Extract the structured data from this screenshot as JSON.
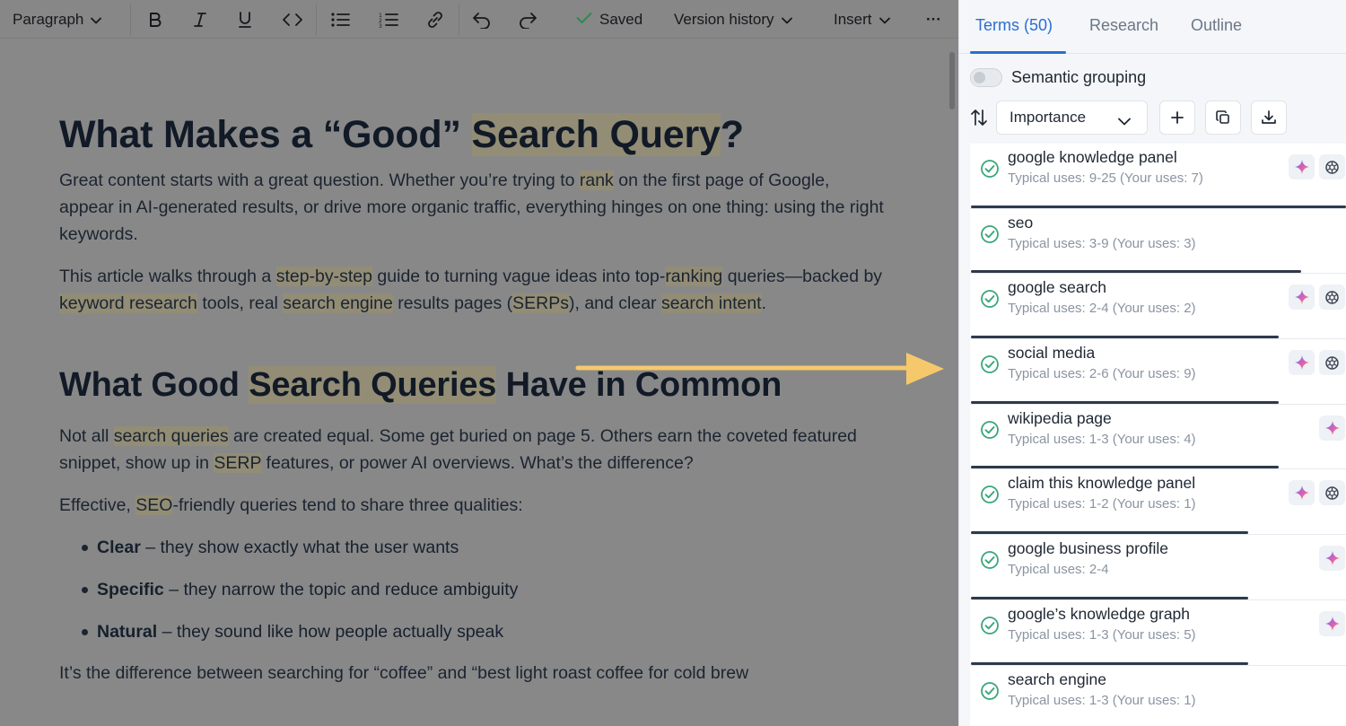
{
  "toolbar": {
    "paragraph_label": "Paragraph",
    "saved_label": "Saved",
    "version_history_label": "Version history",
    "insert_label": "Insert",
    "more_label": "···"
  },
  "document": {
    "h1_a": "What Makes a “Good” ",
    "h1_b": "Search Query",
    "h1_c": "?",
    "p1": [
      "Great content starts with a great question. Whether you’re trying to ",
      "rank",
      " on the first page of Google, appear in AI-generated results, or drive more organic traffic, everything hinges on one thing: using the right keywords."
    ],
    "p2": [
      "This article walks through a ",
      "step-by-step",
      " guide to turning vague ideas into top-",
      "ranking",
      " queries—backed by ",
      "keyword research",
      " tools, real ",
      "search engine",
      " results pages (",
      "SERPs",
      "), and clear ",
      "search intent",
      "."
    ],
    "h2_a": "What Good ",
    "h2_b": "Search Queries",
    "h2_c": " Have in Common",
    "p3": [
      "Not all ",
      "search queries",
      " are created equal. Some get buried on page 5. Others earn the coveted featured snippet, show up in ",
      "SERP",
      " features, or power AI overviews. What’s the difference?"
    ],
    "p4": [
      "Effective, ",
      "SEO",
      "-friendly queries tend to share three qualities:"
    ],
    "bullets": [
      {
        "term": "Clear",
        "rest": " – they show exactly what the user wants"
      },
      {
        "term": "Specific",
        "rest": " – they narrow the topic and reduce ambiguity"
      },
      {
        "term": "Natural",
        "rest": " – they sound like how people actually speak"
      }
    ],
    "p5": "It’s the difference between searching for “coffee” and “best light roast coffee for cold brew"
  },
  "panel": {
    "tabs": [
      "Terms (50)",
      "Research",
      "Outline"
    ],
    "active_tab": "Terms (50)",
    "semantic_grouping_label": "Semantic grouping",
    "sort_select_value": "Importance",
    "terms": [
      {
        "name": "google knowledge panel",
        "uses": "Typical uses: 9-25 (Your uses: 7)",
        "progress": 1.0,
        "actions": [
          "gemini-icon",
          "openai-icon"
        ]
      },
      {
        "name": "seo",
        "uses": "Typical uses: 3-9 (Your uses: 3)",
        "progress": 0.88,
        "actions": []
      },
      {
        "name": "google search",
        "uses": "Typical uses: 2-4 (Your uses: 2)",
        "progress": 0.82,
        "actions": [
          "gemini-icon",
          "openai-icon"
        ]
      },
      {
        "name": "social media",
        "uses": "Typical uses: 2-6 (Your uses: 9)",
        "progress": 0.82,
        "actions": [
          "gemini-icon",
          "openai-icon"
        ]
      },
      {
        "name": "wikipedia page",
        "uses": "Typical uses: 1-3 (Your uses: 4)",
        "progress": 0.82,
        "actions": [
          "gemini-icon"
        ]
      },
      {
        "name": "claim this knowledge panel",
        "uses": "Typical uses: 1-2 (Your uses: 1)",
        "progress": 0.74,
        "actions": [
          "gemini-icon",
          "openai-icon"
        ]
      },
      {
        "name": "google business profile",
        "uses": "Typical uses: 2-4",
        "progress": 0.74,
        "actions": [
          "gemini-icon"
        ]
      },
      {
        "name": "google’s knowledge graph",
        "uses": "Typical uses: 1-3 (Your uses: 5)",
        "progress": 0.74,
        "actions": [
          "gemini-icon"
        ]
      },
      {
        "name": "search engine",
        "uses": "Typical uses: 1-3 (Your uses: 1)",
        "progress": 0.74,
        "actions": []
      }
    ]
  },
  "colors": {
    "accent": "#2a6fd1",
    "check_green": "#3aa77a",
    "arrow": "#f5c96b",
    "highlight": "#938d76"
  }
}
